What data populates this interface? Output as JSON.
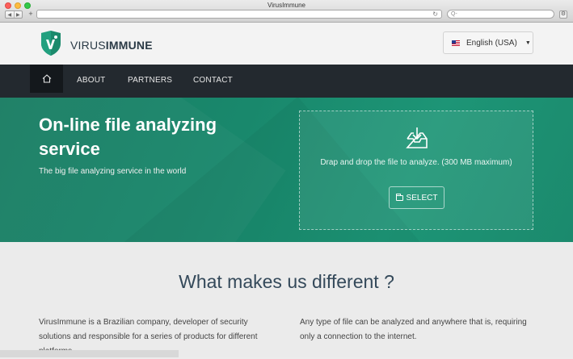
{
  "browser": {
    "window_title": "VirusImmune",
    "address": "",
    "search_placeholder": "Q-"
  },
  "header": {
    "brand_prefix": "VIRUS",
    "brand_suffix": "IMMUNE",
    "language": "English (USA)"
  },
  "nav": {
    "items": [
      {
        "label": "ABOUT"
      },
      {
        "label": "PARTNERS"
      },
      {
        "label": "CONTACT"
      }
    ]
  },
  "hero": {
    "title": "On-line file analyzing service",
    "subtitle": "The big file analyzing service in the world",
    "drop_text": "Drap and drop the file to analyze. (300 MB maximum)",
    "select_label": "SELECT"
  },
  "content": {
    "heading": "What makes us different ?",
    "left_paragraph": "VirusImmune is a Brazilian company, developer of security solutions and responsible for a series of products for different platforms.",
    "right_paragraph": "Any type of file can be analyzed and anywhere that is, requiring only a connection to the internet."
  },
  "colors": {
    "hero_green": "#1a8a6c",
    "nav_dark": "#23292f",
    "heading_blue": "#34495a"
  },
  "icons": [
    "home-icon",
    "inbox-download-icon",
    "folder-icon",
    "shield-logo-icon",
    "us-flag-icon",
    "caret-down-icon",
    "reload-icon",
    "search-icon",
    "settings-icon"
  ]
}
